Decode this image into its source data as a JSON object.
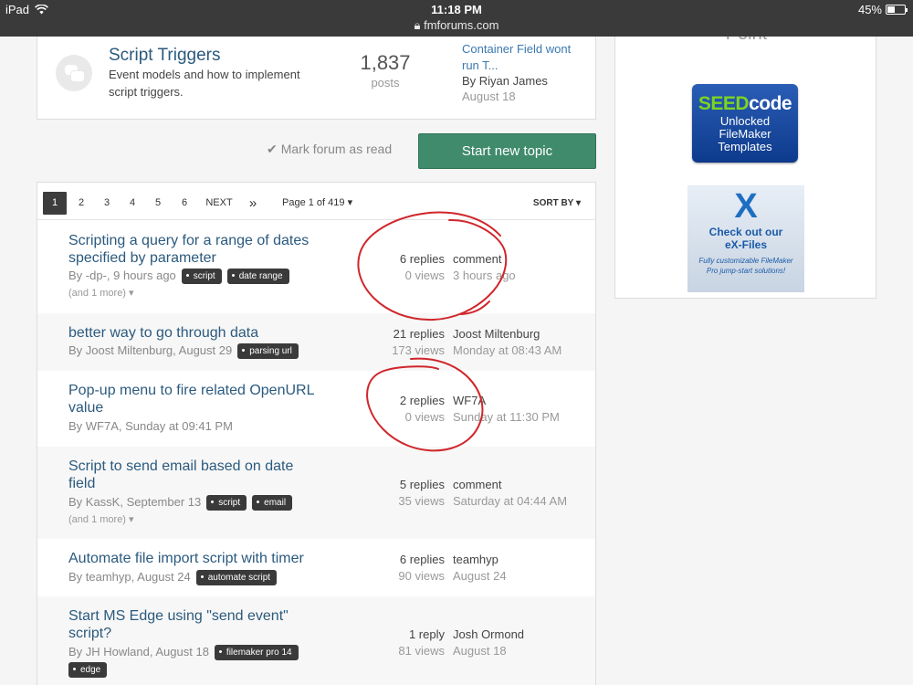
{
  "status_bar": {
    "device": "iPad",
    "time": "11:18 PM",
    "url": "fmforums.com",
    "battery": "45%",
    "battery_level": 0.45
  },
  "forum": {
    "title": "Script Triggers",
    "description": "Event models and how to implement script triggers.",
    "post_count": "1,837",
    "post_label": "posts",
    "last_post_title": "Container Field wont run T...",
    "last_post_by": "By Riyan James",
    "last_post_date": "August 18"
  },
  "actions": {
    "mark_read": "Mark forum as read",
    "start_topic": "Start new topic"
  },
  "pager": {
    "pages": [
      "1",
      "2",
      "3",
      "4",
      "5",
      "6"
    ],
    "next": "NEXT",
    "last": "»",
    "page_info": "Page 1 of 419",
    "sort": "SORT BY"
  },
  "topics": [
    {
      "title": "Scripting a query for a range of dates specified by parameter",
      "meta": "By -dp-, 9 hours ago",
      "tags": [
        "script",
        "date range"
      ],
      "more": "(and 1 more)",
      "replies": "6 replies",
      "views": "0 views",
      "last_user": "comment",
      "last_date": "3 hours ago"
    },
    {
      "title": "better way to go through data",
      "meta": "By Joost Miltenburg, August 29",
      "tags": [
        "parsing url"
      ],
      "replies": "21 replies",
      "views": "173 views",
      "last_user": "Joost Miltenburg",
      "last_date": "Monday at 08:43 AM"
    },
    {
      "title": "Pop-up menu to fire related OpenURL value",
      "meta": "By WF7A, Sunday at 09:41 PM",
      "tags": [],
      "replies": "2 replies",
      "views": "0 views",
      "last_user": "WF7A",
      "last_date": "Sunday at 11:30 PM"
    },
    {
      "title": "Script to send email based on date field",
      "meta": "By KassK, September 13",
      "tags": [
        "script",
        "email"
      ],
      "more": "(and 1 more)",
      "replies": "5 replies",
      "views": "35 views",
      "last_user": "comment",
      "last_date": "Saturday at 04:44 AM"
    },
    {
      "title": "Automate file import script with timer",
      "meta": "By teamhyp, August 24",
      "tags": [
        "automate script"
      ],
      "replies": "6 replies",
      "views": "90 views",
      "last_user": "teamhyp",
      "last_date": "August 24"
    },
    {
      "title": "Start MS Edge using \"send event\" script?",
      "meta": "By JH Howland, August 18",
      "tags": [
        "filemaker pro 14",
        "edge"
      ],
      "replies": "1 reply",
      "views": "81 views",
      "last_user": "Josh Ormond",
      "last_date": "August 18"
    }
  ],
  "sidebar": {
    "partial_heading": "Point",
    "seedcode": {
      "brand_a": "SEED",
      "brand_b": "code",
      "line1": "Unlocked",
      "line2": "FileMaker",
      "line3": "Templates"
    },
    "exfiles": {
      "mark": "X",
      "line1": "Check out our",
      "line2": "eX-Files",
      "line3": "Fully customizable FileMaker Pro jump-start solutions!"
    }
  },
  "colors": {
    "link": "#2b5a7e",
    "primary_button": "#3f8b6c",
    "annotation": "#d0262b"
  }
}
